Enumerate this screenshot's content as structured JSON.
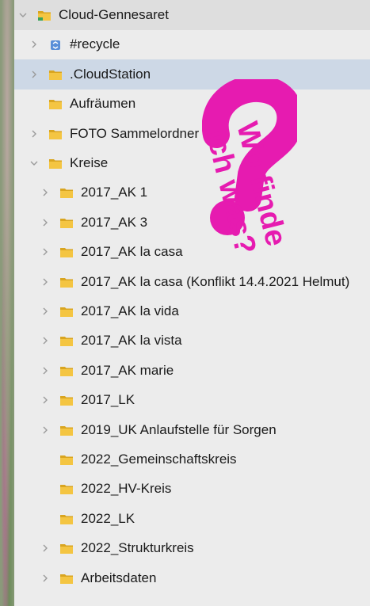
{
  "colors": {
    "folder": "#f4c542",
    "folder_dark": "#d9a520",
    "accent_magenta": "#e61bb0",
    "highlight_row": "#cdd8e6"
  },
  "tree": [
    {
      "label": "Cloud-Gennesaret",
      "level": 0,
      "chevron": "down",
      "icon": "cloud-folder-icon",
      "selected": true
    },
    {
      "label": "#recycle",
      "level": 1,
      "chevron": "right",
      "icon": "recycle-bin-icon"
    },
    {
      "label": ".CloudStation",
      "level": 1,
      "chevron": "right",
      "icon": "folder-icon",
      "highlighted": true
    },
    {
      "label": "Aufräumen",
      "level": 1,
      "chevron": "none",
      "icon": "folder-icon"
    },
    {
      "label": "FOTO Sammelordner",
      "level": 1,
      "chevron": "right",
      "icon": "folder-icon"
    },
    {
      "label": "Kreise",
      "level": 1,
      "chevron": "down",
      "icon": "folder-icon"
    },
    {
      "label": "2017_AK 1",
      "level": 2,
      "chevron": "right",
      "icon": "folder-icon"
    },
    {
      "label": "2017_AK 3",
      "level": 2,
      "chevron": "right",
      "icon": "folder-icon"
    },
    {
      "label": "2017_AK la casa",
      "level": 2,
      "chevron": "right",
      "icon": "folder-icon"
    },
    {
      "label": "2017_AK la casa (Konflikt 14.4.2021 Helmut)",
      "level": 2,
      "chevron": "right",
      "icon": "folder-icon"
    },
    {
      "label": "2017_AK la vida",
      "level": 2,
      "chevron": "right",
      "icon": "folder-icon"
    },
    {
      "label": "2017_AK la vista",
      "level": 2,
      "chevron": "right",
      "icon": "folder-icon"
    },
    {
      "label": "2017_AK marie",
      "level": 2,
      "chevron": "right",
      "icon": "folder-icon"
    },
    {
      "label": "2017_LK",
      "level": 2,
      "chevron": "right",
      "icon": "folder-icon"
    },
    {
      "label": "2019_UK Anlaufstelle für Sorgen",
      "level": 2,
      "chevron": "right",
      "icon": "folder-icon"
    },
    {
      "label": "2022_Gemeinschaftskreis",
      "level": 2,
      "chevron": "none",
      "icon": "folder-icon"
    },
    {
      "label": "2022_HV-Kreis",
      "level": 2,
      "chevron": "none",
      "icon": "folder-icon"
    },
    {
      "label": "2022_LK",
      "level": 2,
      "chevron": "none",
      "icon": "folder-icon"
    },
    {
      "label": "2022_Strukturkreis",
      "level": 2,
      "chevron": "right",
      "icon": "folder-icon"
    },
    {
      "label": "Arbeitsdaten",
      "level": 2,
      "chevron": "right",
      "icon": "folder-icon"
    }
  ],
  "annotation": {
    "line1": "Wo finde",
    "line2": "ich was?"
  }
}
